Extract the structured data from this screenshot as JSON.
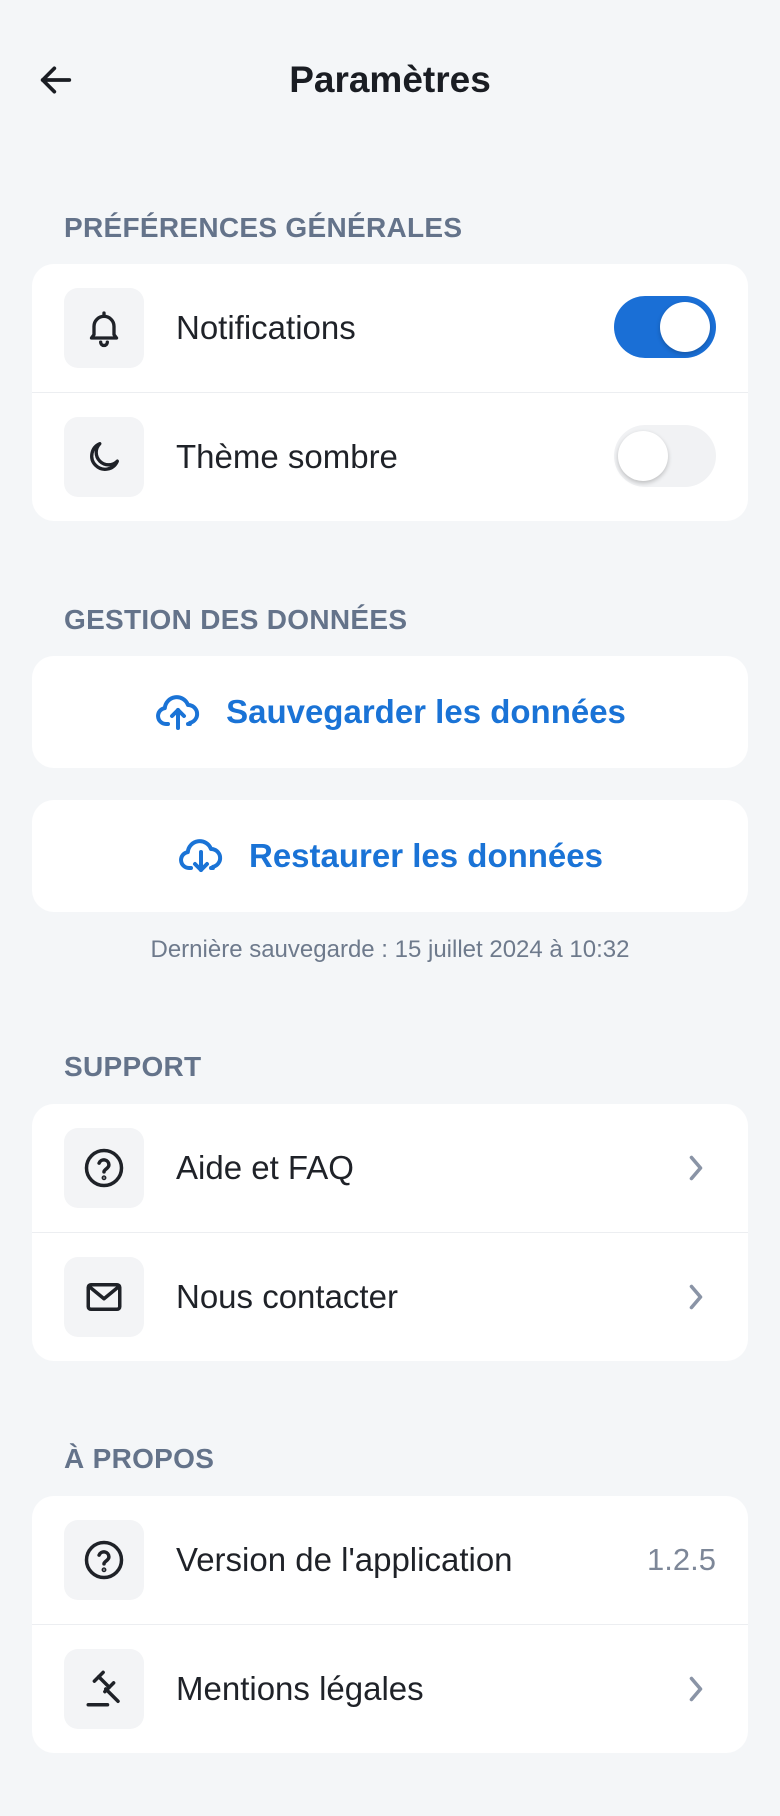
{
  "header": {
    "title": "Paramètres"
  },
  "general": {
    "section_label": "PRÉFÉRENCES GÉNÉRALES",
    "items": [
      {
        "label": "Notifications",
        "icon": "bell-icon",
        "toggle": true
      },
      {
        "label": "Thème sombre",
        "icon": "moon-icon",
        "toggle": false
      }
    ]
  },
  "data": {
    "section_label": "GESTION DES DONNÉES",
    "backup_label": "Sauvegarder les données",
    "restore_label": "Restaurer les données",
    "last_backup": "Dernière sauvegarde : 15 juillet 2024 à 10:32"
  },
  "support": {
    "section_label": "SUPPORT",
    "items": [
      {
        "label": "Aide et FAQ",
        "icon": "help-circle-icon"
      },
      {
        "label": "Nous contacter",
        "icon": "mail-icon"
      }
    ]
  },
  "about": {
    "section_label": "À PROPOS",
    "items": [
      {
        "label": "Version de l'application",
        "icon": "help-circle-icon",
        "value": "1.2.5"
      },
      {
        "label": "Mentions légales",
        "icon": "gavel-icon"
      }
    ]
  },
  "colors": {
    "accent": "#1a73d6",
    "toggle_on": "#1a6fd6",
    "section_label": "#64738a",
    "background": "#f4f6f8"
  }
}
